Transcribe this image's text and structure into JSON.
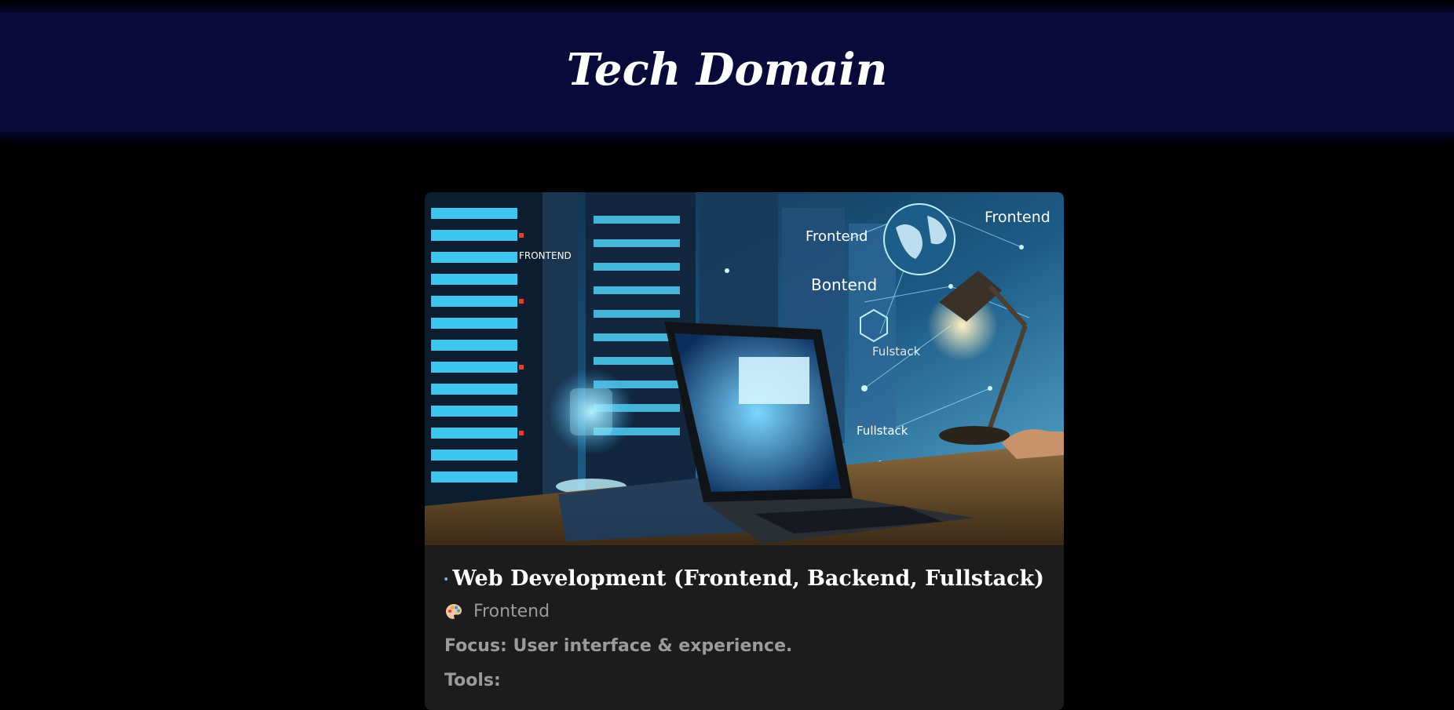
{
  "header": {
    "title": "Tech Domain"
  },
  "card": {
    "image_labels": {
      "frontend_small": "FRONTEND",
      "frontend_a": "Frontend",
      "frontend_b": "Frontend",
      "bontend": "Bontend",
      "fullstack_a": "Fulstack",
      "fullstack_b": "Fullstack"
    },
    "title": "Web Development (Frontend, Backend, Fullstack)",
    "title_icon": "globe-icon",
    "section": {
      "icon": "palette-icon",
      "label": "Frontend"
    },
    "focus": {
      "label": "Focus:",
      "value": "User interface & experience."
    },
    "tools_label": "Tools:"
  },
  "colors": {
    "page_background": "#000000",
    "header_background": "#0a0a3a",
    "card_background": "#1c1c1c",
    "title_text": "#ffffff",
    "muted_text": "#9b9b9b"
  }
}
